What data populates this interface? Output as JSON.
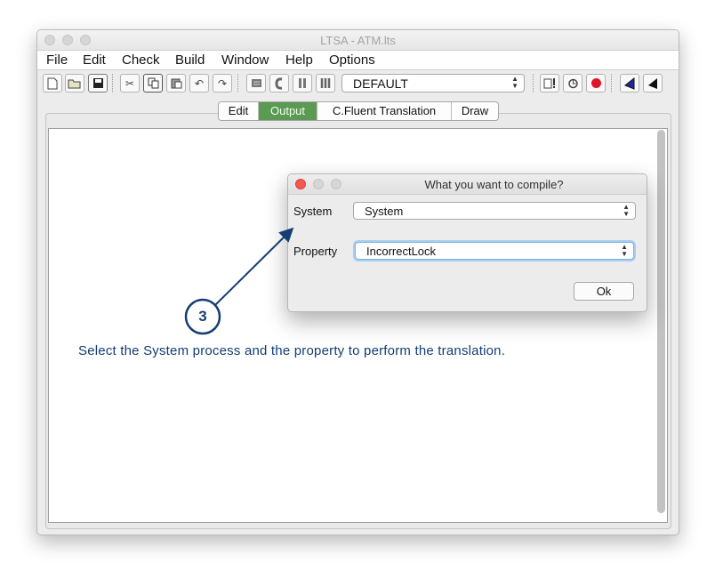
{
  "window": {
    "title": "LTSA - ATM.lts"
  },
  "menubar": {
    "items": [
      "File",
      "Edit",
      "Check",
      "Build",
      "Window",
      "Help",
      "Options"
    ]
  },
  "toolbar": {
    "target_combo_value": "DEFAULT",
    "icons": [
      "new-file-icon",
      "open-folder-icon",
      "save-icon",
      "cut-icon",
      "copy-icon",
      "paste-icon",
      "undo-icon",
      "redo-icon",
      "stop-icon",
      "compile-icon",
      "pause-icon",
      "parallel-icon",
      "safety-check-icon",
      "progress-check-icon",
      "red-stop-icon",
      "draw-blue-icon",
      "draw-black-icon"
    ]
  },
  "tabs": {
    "items": [
      "Edit",
      "Output",
      "C.Fluent Translation",
      "Draw"
    ],
    "active": "Output"
  },
  "dialog": {
    "title": "What you want to compile?",
    "system_label": "System",
    "system_value": "System",
    "property_label": "Property",
    "property_value": "IncorrectLock",
    "ok_label": "Ok"
  },
  "annotation": {
    "step_number": "3",
    "caption": "Select the System process and the property to perform the translation.",
    "color": "#143d74"
  }
}
